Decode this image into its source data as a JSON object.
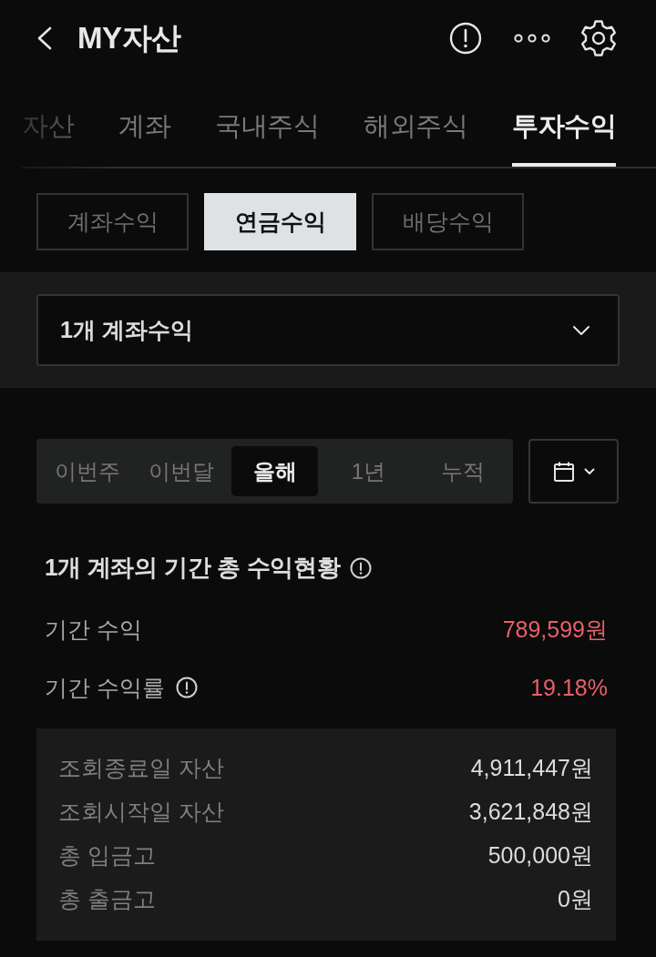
{
  "header": {
    "title": "MY자산"
  },
  "tabs": [
    {
      "label": "자산",
      "selected": false
    },
    {
      "label": "계좌",
      "selected": false
    },
    {
      "label": "국내주식",
      "selected": false
    },
    {
      "label": "해외주식",
      "selected": false
    },
    {
      "label": "투자수익",
      "selected": true
    }
  ],
  "sub_tabs": [
    {
      "label": "계좌수익",
      "selected": false
    },
    {
      "label": "연금수익",
      "selected": true
    },
    {
      "label": "배당수익",
      "selected": false
    }
  ],
  "account_select": {
    "value": "1개 계좌수익"
  },
  "periods": [
    {
      "label": "이번주",
      "selected": false
    },
    {
      "label": "이번달",
      "selected": false
    },
    {
      "label": "올해",
      "selected": true
    },
    {
      "label": "1년",
      "selected": false
    },
    {
      "label": "누적",
      "selected": false
    }
  ],
  "summary": {
    "title": "1개 계좌의 기간 총 수익현황",
    "rows": [
      {
        "label": "기간 수익",
        "value": "789,599원",
        "info": false
      },
      {
        "label": "기간 수익률",
        "value": "19.18%",
        "info": true
      }
    ]
  },
  "details": [
    {
      "label": "조회종료일 자산",
      "value": "4,911,447원"
    },
    {
      "label": "조회시작일 자산",
      "value": "3,621,848원"
    },
    {
      "label": "총 입금고",
      "value": "500,000원"
    },
    {
      "label": "총 출금고",
      "value": "0원"
    }
  ]
}
